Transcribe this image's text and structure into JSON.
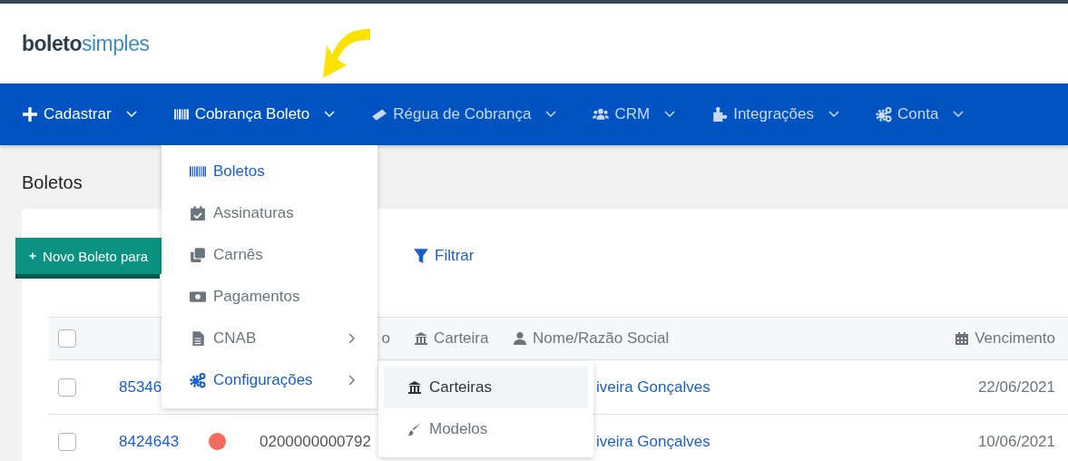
{
  "logo": "**boleto**simples",
  "nav": [
    {
      "label": "Cadastrar",
      "emphasized": true
    },
    {
      "label": "Cobrança Boleto",
      "emphasized": true
    },
    {
      "label": "Régua de Cobrança",
      "emphasized": false
    },
    {
      "label": "CRM",
      "emphasized": false
    },
    {
      "label": "Integrações",
      "emphasized": false
    },
    {
      "label": "Conta",
      "emphasized": false
    }
  ],
  "page_title": "Boletos",
  "new_button": "Novo Boleto para",
  "filter_button": "Filtrar",
  "table": {
    "select_all": {
      "checked": false
    },
    "columns": [
      {
        "label": "o"
      },
      {
        "label": "Carteira"
      },
      {
        "label": "Nome/Razão Social"
      },
      {
        "label": "Vencimento"
      }
    ],
    "rows": [
      {
        "checked": false,
        "id": "85346",
        "name": "iveira Gonçalves",
        "due": "22/06/2021"
      },
      {
        "checked": false,
        "id": "8424643",
        "color": "#f26b5e",
        "code": "0200000000792",
        "name": "iveira Gonçalves",
        "due": "10/06/2021"
      }
    ]
  },
  "menu": [
    {
      "label": "Boletos",
      "selected": true,
      "submenu": false
    },
    {
      "label": "Assinaturas",
      "selected": false,
      "submenu": false
    },
    {
      "label": "Carnês",
      "selected": false,
      "submenu": false
    },
    {
      "label": "Pagamentos",
      "selected": false,
      "submenu": false
    },
    {
      "label": "CNAB",
      "selected": false,
      "submenu": true
    },
    {
      "label": "Configurações",
      "selected": true,
      "submenu": true
    }
  ],
  "submenu": [
    {
      "label": "Carteiras",
      "selected": true
    },
    {
      "label": "Modelos",
      "selected": false
    }
  ]
}
